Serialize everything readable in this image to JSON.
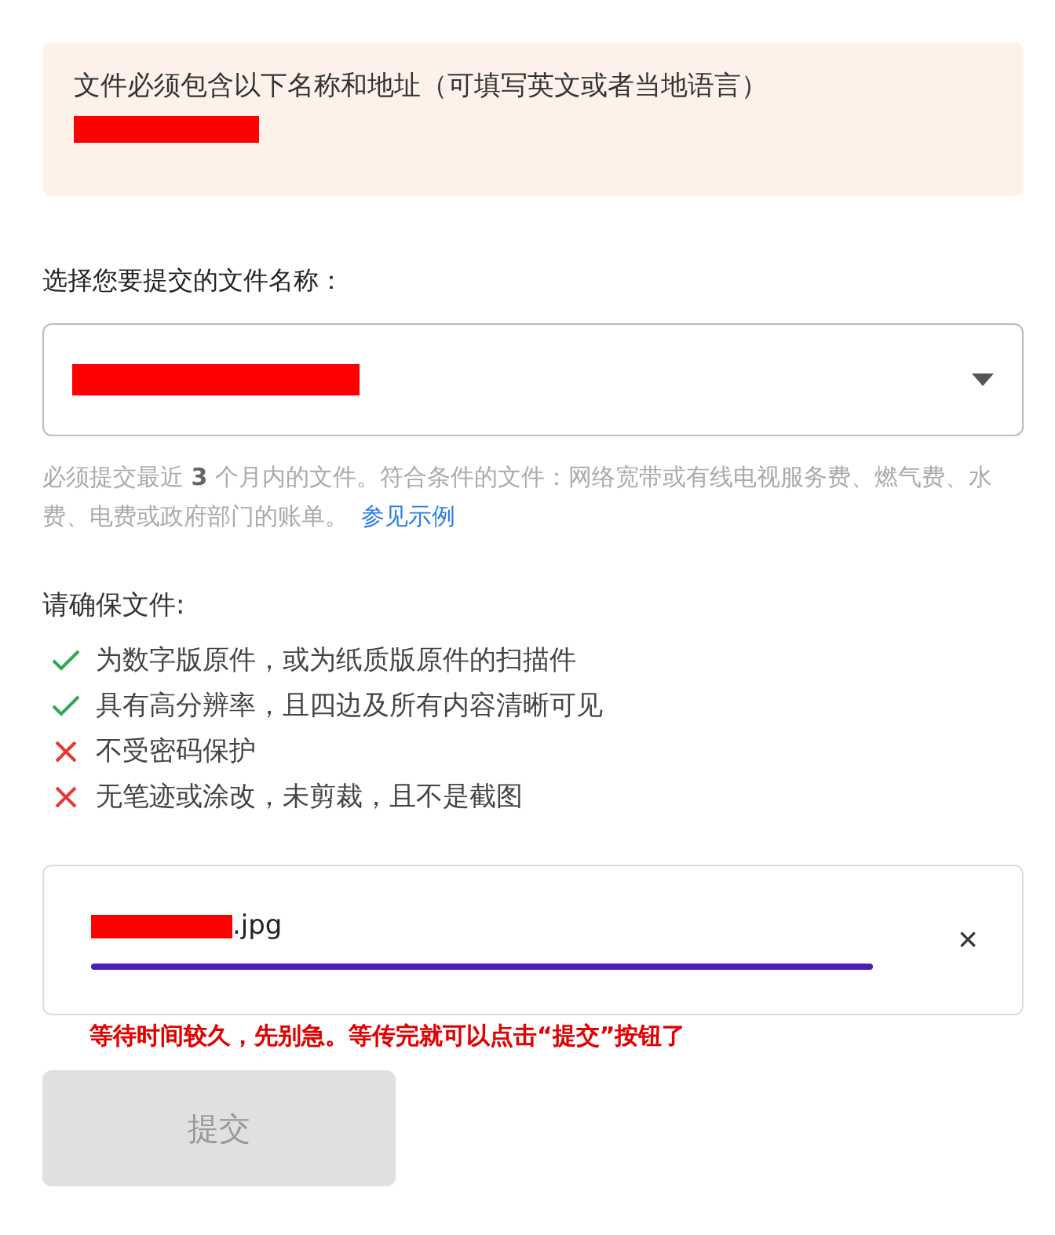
{
  "notice": {
    "text": "文件必须包含以下名称和地址（可填写英文或者当地语言）",
    "redacted": true
  },
  "document_select": {
    "label": "选择您要提交的文件名称：",
    "value_redacted": true
  },
  "hint": {
    "text": "必须提交最近 **3** 个月内的文件。符合条件的文件：网络宽带或有线电视服务费、燃气费、水费、电费或政府部门的账单。",
    "link": "参见示例"
  },
  "requirements": {
    "title": "请确保文件:",
    "items": [
      {
        "text": "为数字版原件，或为纸质版原件的扫描件",
        "kind": "allowed"
      },
      {
        "text": "具有高分辨率，且四边及所有内容清晰可见",
        "kind": "allowed"
      },
      {
        "text": "不受密码保护",
        "kind": "forbidden"
      },
      {
        "text": "无笔迹或涂改，未剪裁，且不是截图",
        "kind": "forbidden"
      }
    ]
  },
  "upload": {
    "file_name": ".jpg",
    "name_redacted": true,
    "level": 1,
    "remove": "×"
  },
  "note": "等待时间较久，先别急。等传完就可以点击“提交”按钮了",
  "submit": {
    "label": "提交",
    "disabled": true
  }
}
